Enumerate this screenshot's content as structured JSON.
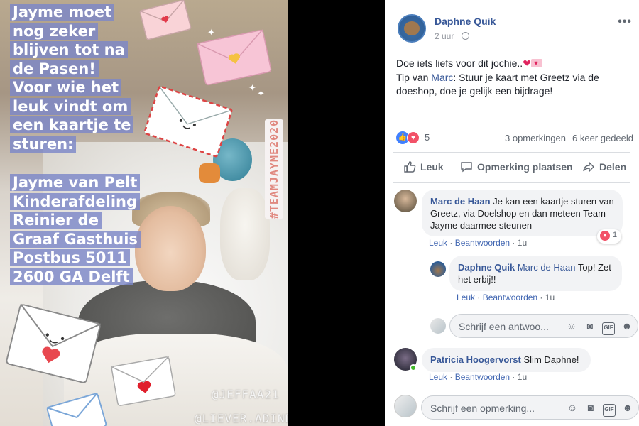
{
  "story": {
    "text_lines": [
      "Jayme moet",
      "nog zeker",
      "blijven tot na",
      "de Pasen!",
      "Voor wie het",
      "leuk vindt om",
      "een kaartje te",
      "sturen:"
    ],
    "address_lines": [
      "Jayme van Pelt",
      "Kinderafdeling",
      "Reinier de",
      "Graaf Gasthuis",
      "Postbus 5011",
      "2600 GA Delft"
    ],
    "hashtag": "#TEAMJAYME2020",
    "mention_1": "@JEFFAA21",
    "mention_2": "@LIEVER.ADINDA",
    "colors": {
      "text_highlight": "#7c87c8",
      "hashtag_text": "#e0887f"
    }
  },
  "post": {
    "author": "Daphne Quik",
    "time": "2 uur",
    "more_icon": "more-options-icon",
    "body_line_1": "Doe iets liefs voor dit jochie..",
    "body_tip_prefix": "Tip van ",
    "body_tip_link": "Marc",
    "body_tip_rest": ": Stuur je kaart met Greetz via de doeshop, doe je gelijk een bijdrage!",
    "reaction_count": "5",
    "comments_count": "3 opmerkingen",
    "shares_count": "6 keer gedeeld",
    "actions": {
      "like": "Leuk",
      "comment": "Opmerking plaatsen",
      "share": "Delen"
    },
    "colors": {
      "link": "#385898",
      "like_blue": "#4080ff",
      "love_red": "#f25268"
    }
  },
  "comments": [
    {
      "author": "Marc de Haan",
      "text": "Je kan een kaartje sturen van Greetz, via Doelshop en dan meteen Team Jayme daarmee steunen",
      "like": "Leuk",
      "reply": "Beantwoorden",
      "time": "1u",
      "reactions": "1"
    },
    {
      "author": "Daphne Quik",
      "mention": "Marc de Haan",
      "text": "Top! Zet het erbij!!",
      "like": "Leuk",
      "reply": "Beantwoorden",
      "time": "1u"
    },
    {
      "author": "Patricia Hoogervorst",
      "text": "Slim Daphne!",
      "like": "Leuk",
      "reply": "Beantwoorden",
      "time": "1u"
    }
  ],
  "reply_input": {
    "placeholder": "Schrijf een antwoo..."
  },
  "comment_input": {
    "placeholder": "Schrijf een opmerking..."
  },
  "input_icons": {
    "emoji": "emoji-icon",
    "camera": "camera-icon",
    "gif": "GIF",
    "sticker": "sticker-icon"
  }
}
